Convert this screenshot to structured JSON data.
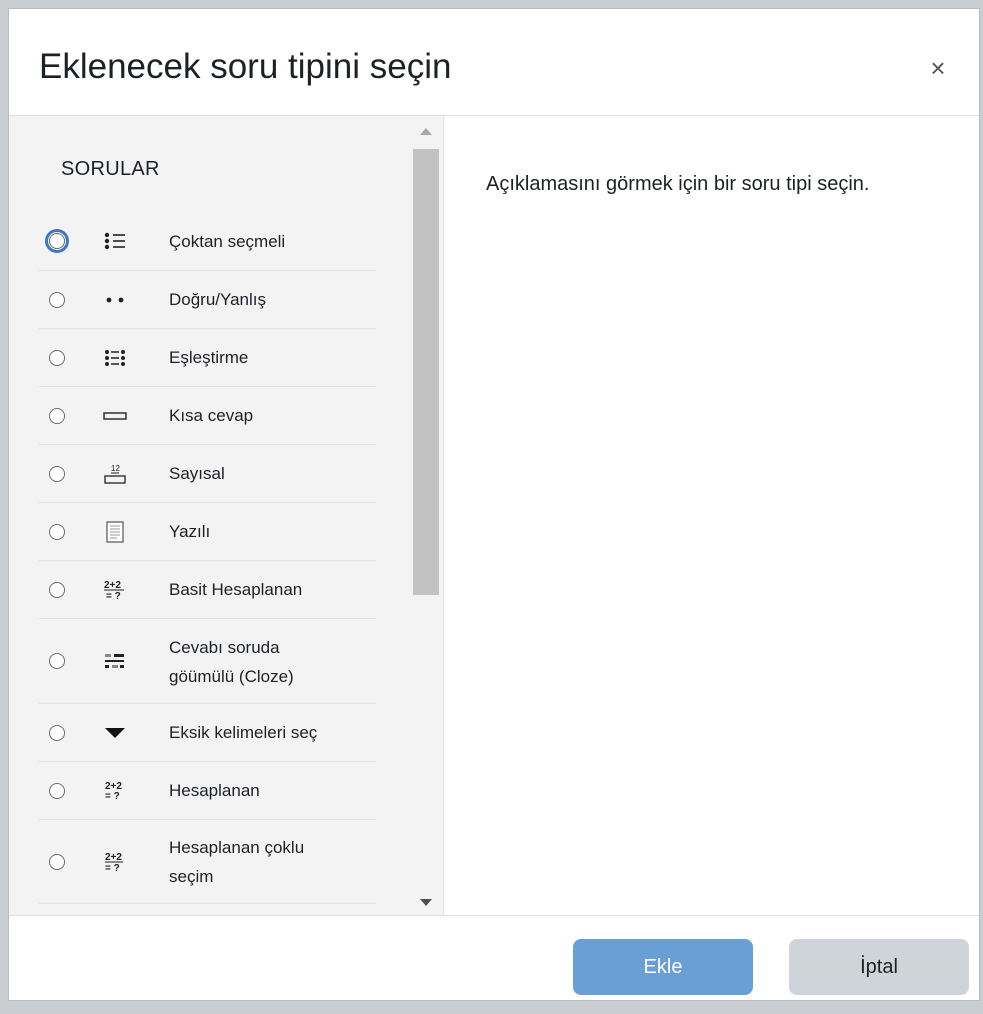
{
  "dialog": {
    "title": "Eklenecek soru tipini seçin",
    "close_symbol": "×"
  },
  "list": {
    "section_title": "SORULAR",
    "items": [
      {
        "label": "Çoktan seçmeli",
        "icon": "multichoice-icon"
      },
      {
        "label": "Doğru/Yanlış",
        "icon": "truefalse-icon"
      },
      {
        "label": "Eşleştirme",
        "icon": "matching-icon"
      },
      {
        "label": "Kısa cevap",
        "icon": "shortanswer-icon"
      },
      {
        "label": "Sayısal",
        "icon": "numerical-icon"
      },
      {
        "label": "Yazılı",
        "icon": "essay-icon"
      },
      {
        "label": "Basit Hesaplanan",
        "icon": "calculatedsimple-icon"
      },
      {
        "label": "Cevabı soruda göümülü (Cloze)",
        "icon": "cloze-icon"
      },
      {
        "label": "Eksik kelimeleri seç",
        "icon": "gapselect-icon"
      },
      {
        "label": "Hesaplanan",
        "icon": "calculated-icon"
      },
      {
        "label": "Hesaplanan çoklu seçim",
        "icon": "calculatedmulti-icon"
      }
    ]
  },
  "description": "Açıklamasını görmek için bir soru tipi seçin.",
  "footer": {
    "add_label": "Ekle",
    "cancel_label": "İptal"
  },
  "icon_text": {
    "numerical": "12",
    "calc_top": "2+2",
    "calc_bottom": "= ?"
  }
}
